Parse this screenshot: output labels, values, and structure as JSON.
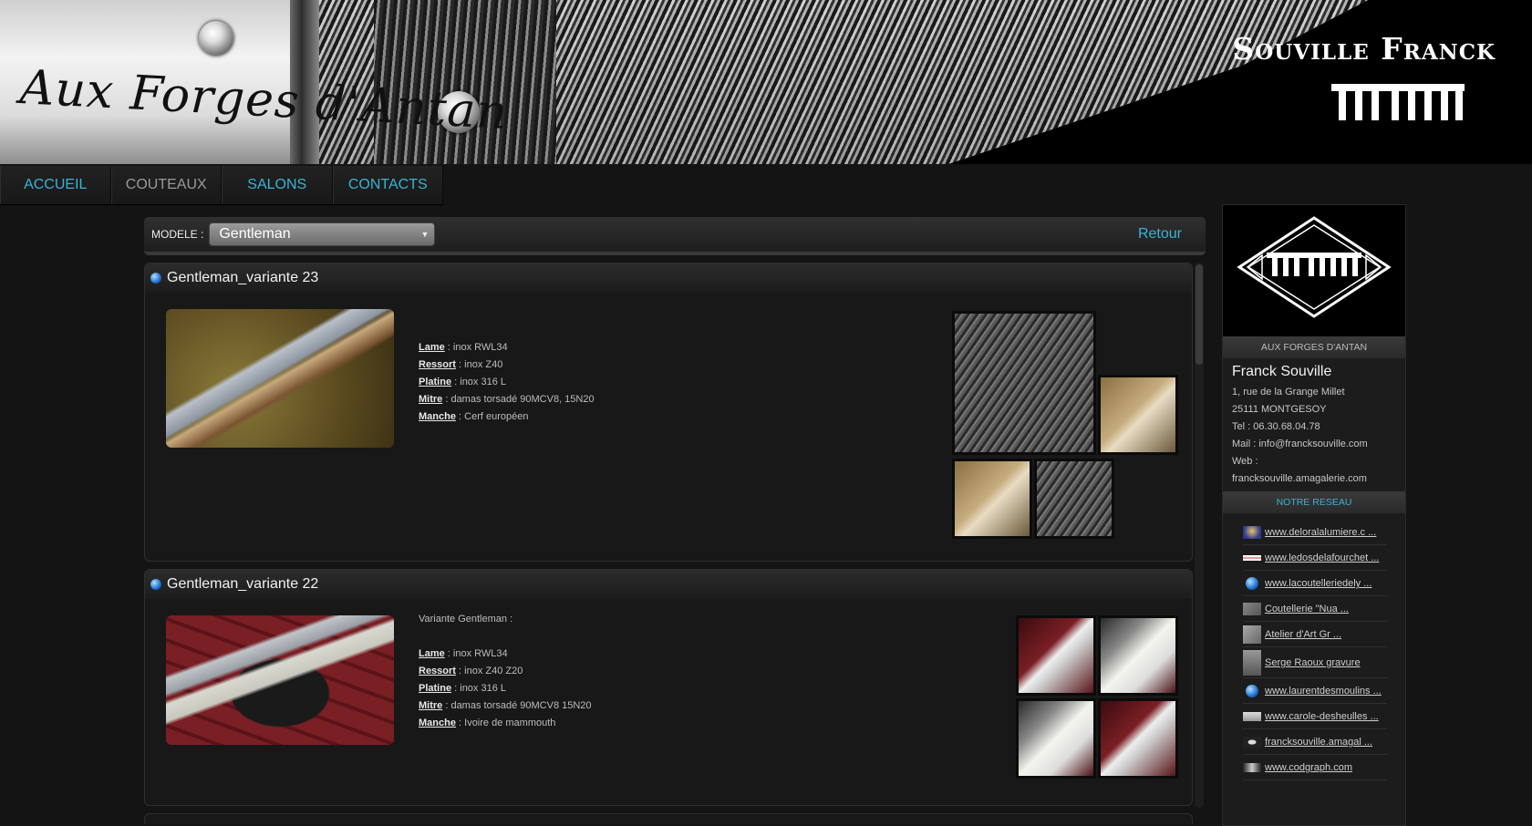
{
  "banner": {
    "script_title": "Aux Forges d'Antan",
    "brand_name": "Souville Franck"
  },
  "nav": {
    "items": [
      {
        "label": "ACCUEIL"
      },
      {
        "label": "COUTEAUX"
      },
      {
        "label": "SALONS"
      },
      {
        "label": "CONTACTS"
      }
    ]
  },
  "filter": {
    "label": "MODELE :",
    "selected_model": "Gentleman",
    "back_label": "Retour"
  },
  "entries": [
    {
      "title": "Gentleman_variante 23",
      "intro": "",
      "specs": [
        {
          "key": "Lame",
          "value": " : inox RWL34"
        },
        {
          "key": "Ressort",
          "value": " : inox Z40"
        },
        {
          "key": "Platine",
          "value": " : inox 316 L"
        },
        {
          "key": "Mitre",
          "value": " : damas torsadé 90MCV8, 15N20"
        },
        {
          "key": "Manche",
          "value": " : Cerf européen"
        }
      ]
    },
    {
      "title": "Gentleman_variante 22",
      "intro": "Variante Gentleman :",
      "specs": [
        {
          "key": "Lame",
          "value": " : inox RWL34"
        },
        {
          "key": "Ressort",
          "value": " : inox Z40 Z20"
        },
        {
          "key": "Platine",
          "value": " : inox 316 L"
        },
        {
          "key": "Mitre",
          "value": " : damas torsadé 90MCV8 15N20"
        },
        {
          "key": "Manche",
          "value": " : Ivoire de mammouth"
        }
      ]
    }
  ],
  "sidebar": {
    "caption": "AUX FORGES D'ANTAN",
    "name": "Franck Souville",
    "address1": "1, rue de la Grange Millet",
    "address2": "25111 MONTGESOY",
    "tel": "Tel : 06.30.68.04.78",
    "mail": "Mail : info@francksouville.com",
    "web_label": "Web :",
    "web_url": "francksouville.amagalerie.com",
    "network_title": "NOTRE RESEAU",
    "network": [
      {
        "label": "www.deloralalumiere.c ...",
        "icon": "avatar-icon"
      },
      {
        "label": "www.ledosdelafourchet ...",
        "icon": "flag-icon"
      },
      {
        "label": "www.lacoutelleriedely ...",
        "icon": "globe-icon"
      },
      {
        "label": "Coutellerie \"Nua ...",
        "icon": "image-icon"
      },
      {
        "label": "Atelier d'Art Gr ...",
        "icon": "image-icon"
      },
      {
        "label": "Serge Raoux gravure",
        "icon": "image-icon"
      },
      {
        "label": "www.laurentdesmoulins ...",
        "icon": "globe-icon"
      },
      {
        "label": "www.carole-desheulles ...",
        "icon": "image-icon"
      },
      {
        "label": "francksouville.amagal ...",
        "icon": "logo-icon"
      },
      {
        "label": "www.codgraph.com",
        "icon": "logo-icon"
      }
    ]
  },
  "colors": {
    "accent": "#3ab3d6",
    "background": "#141414",
    "panel": "#181818"
  }
}
